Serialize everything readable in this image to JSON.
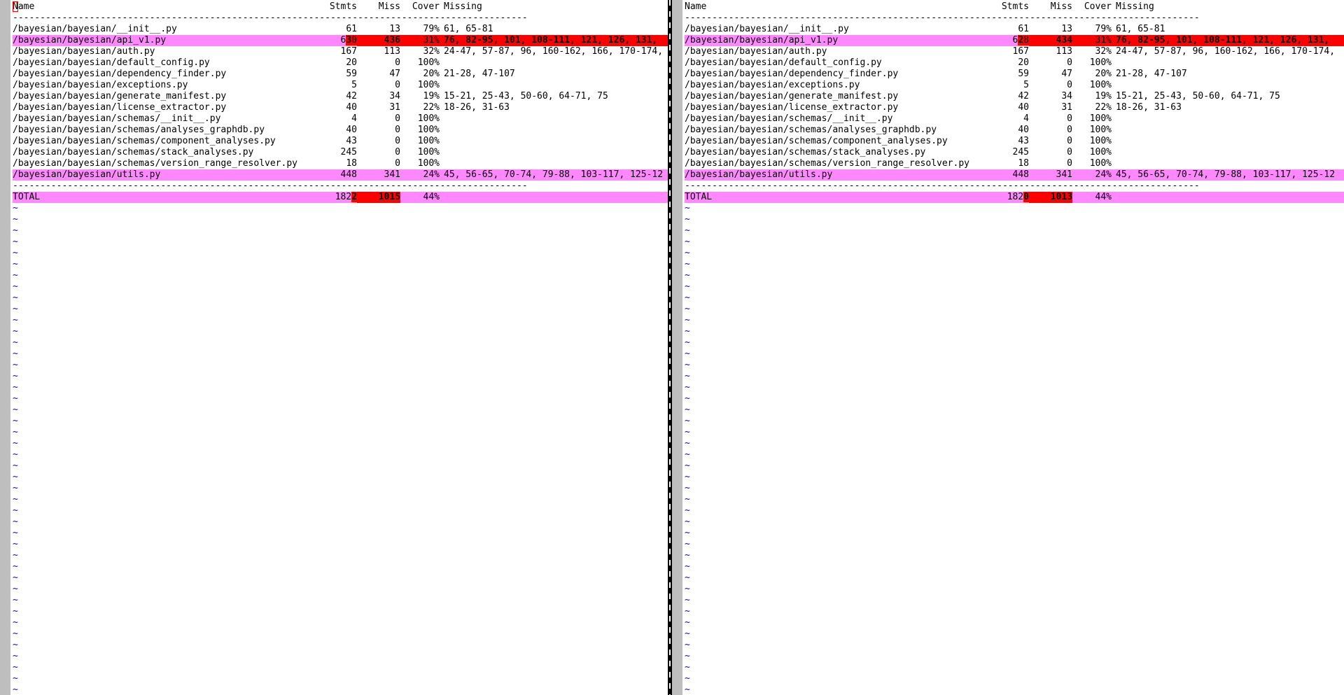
{
  "header": {
    "name": "Name",
    "stmts": "Stmts",
    "miss": "Miss",
    "cover": "Cover",
    "missing": "Missing"
  },
  "separator": "----------------------------------------------------------------------------------------------",
  "tilde": "~",
  "left": {
    "rows": [
      {
        "name": "/bayesian/bayesian/__init__.py",
        "stmts": "61",
        "miss": "13",
        "cover": "79%",
        "missing": "61, 65-81"
      },
      {
        "name": "/bayesian/bayesian/api_v1.py",
        "stmts_pre": "6",
        "stmts_diff": "3",
        "stmts_post": "0",
        "miss": "436",
        "cover": "31%",
        "missing": "76, 82-95, 101, 108-111, 121, 126, 131,"
      },
      {
        "name": "/bayesian/bayesian/auth.py",
        "stmts": "167",
        "miss": "113",
        "cover": "32%",
        "missing": "24-47, 57-87, 96, 160-162, 166, 170-174,"
      },
      {
        "name": "/bayesian/bayesian/default_config.py",
        "stmts": "20",
        "miss": "0",
        "cover": "100%",
        "missing": ""
      },
      {
        "name": "/bayesian/bayesian/dependency_finder.py",
        "stmts": "59",
        "miss": "47",
        "cover": "20%",
        "missing": "21-28, 47-107"
      },
      {
        "name": "/bayesian/bayesian/exceptions.py",
        "stmts": "5",
        "miss": "0",
        "cover": "100%",
        "missing": ""
      },
      {
        "name": "/bayesian/bayesian/generate_manifest.py",
        "stmts": "42",
        "miss": "34",
        "cover": "19%",
        "missing": "15-21, 25-43, 50-60, 64-71, 75"
      },
      {
        "name": "/bayesian/bayesian/license_extractor.py",
        "stmts": "40",
        "miss": "31",
        "cover": "22%",
        "missing": "18-26, 31-63"
      },
      {
        "name": "/bayesian/bayesian/schemas/__init__.py",
        "stmts": "4",
        "miss": "0",
        "cover": "100%",
        "missing": ""
      },
      {
        "name": "/bayesian/bayesian/schemas/analyses_graphdb.py",
        "stmts": "40",
        "miss": "0",
        "cover": "100%",
        "missing": ""
      },
      {
        "name": "/bayesian/bayesian/schemas/component_analyses.py",
        "stmts": "43",
        "miss": "0",
        "cover": "100%",
        "missing": ""
      },
      {
        "name": "/bayesian/bayesian/schemas/stack_analyses.py",
        "stmts": "245",
        "miss": "0",
        "cover": "100%",
        "missing": ""
      },
      {
        "name": "/bayesian/bayesian/schemas/version_range_resolver.py",
        "stmts": "18",
        "miss": "0",
        "cover": "100%",
        "missing": ""
      },
      {
        "name": "/bayesian/bayesian/utils.py",
        "stmts": "448",
        "miss": "341",
        "cover": "24%",
        "missing": "45, 56-65, 70-74, 79-88, 103-117, 125-12"
      }
    ],
    "total": {
      "name": "TOTAL",
      "stmts_pre": "182",
      "stmts_diff": "2",
      "miss": "1015",
      "cover": "44%"
    }
  },
  "right": {
    "rows": [
      {
        "name": "/bayesian/bayesian/__init__.py",
        "stmts": "61",
        "miss": "13",
        "cover": "79%",
        "missing": "61, 65-81"
      },
      {
        "name": "/bayesian/bayesian/api_v1.py",
        "stmts_pre": "6",
        "stmts_diff": "2",
        "stmts_post": "8",
        "miss": "434",
        "cover": "31%",
        "missing": "76, 82-95, 101, 108-111, 121, 126, 131,"
      },
      {
        "name": "/bayesian/bayesian/auth.py",
        "stmts": "167",
        "miss": "113",
        "cover": "32%",
        "missing": "24-47, 57-87, 96, 160-162, 166, 170-174,"
      },
      {
        "name": "/bayesian/bayesian/default_config.py",
        "stmts": "20",
        "miss": "0",
        "cover": "100%",
        "missing": ""
      },
      {
        "name": "/bayesian/bayesian/dependency_finder.py",
        "stmts": "59",
        "miss": "47",
        "cover": "20%",
        "missing": "21-28, 47-107"
      },
      {
        "name": "/bayesian/bayesian/exceptions.py",
        "stmts": "5",
        "miss": "0",
        "cover": "100%",
        "missing": ""
      },
      {
        "name": "/bayesian/bayesian/generate_manifest.py",
        "stmts": "42",
        "miss": "34",
        "cover": "19%",
        "missing": "15-21, 25-43, 50-60, 64-71, 75"
      },
      {
        "name": "/bayesian/bayesian/license_extractor.py",
        "stmts": "40",
        "miss": "31",
        "cover": "22%",
        "missing": "18-26, 31-63"
      },
      {
        "name": "/bayesian/bayesian/schemas/__init__.py",
        "stmts": "4",
        "miss": "0",
        "cover": "100%",
        "missing": ""
      },
      {
        "name": "/bayesian/bayesian/schemas/analyses_graphdb.py",
        "stmts": "40",
        "miss": "0",
        "cover": "100%",
        "missing": ""
      },
      {
        "name": "/bayesian/bayesian/schemas/component_analyses.py",
        "stmts": "43",
        "miss": "0",
        "cover": "100%",
        "missing": ""
      },
      {
        "name": "/bayesian/bayesian/schemas/stack_analyses.py",
        "stmts": "245",
        "miss": "0",
        "cover": "100%",
        "missing": ""
      },
      {
        "name": "/bayesian/bayesian/schemas/version_range_resolver.py",
        "stmts": "18",
        "miss": "0",
        "cover": "100%",
        "missing": ""
      },
      {
        "name": "/bayesian/bayesian/utils.py",
        "stmts": "448",
        "miss": "341",
        "cover": "24%",
        "missing": "45, 56-65, 70-74, 79-88, 103-117, 125-12"
      }
    ],
    "total": {
      "name": "TOTAL",
      "stmts_pre": "182",
      "stmts_diff": "0",
      "miss": "1013",
      "cover": "44%"
    }
  },
  "colors": {
    "changed_line": "#ff88ff",
    "diff_text": "#ff0000",
    "fold_column": "#bebebe",
    "tilde": "#0000ff"
  }
}
